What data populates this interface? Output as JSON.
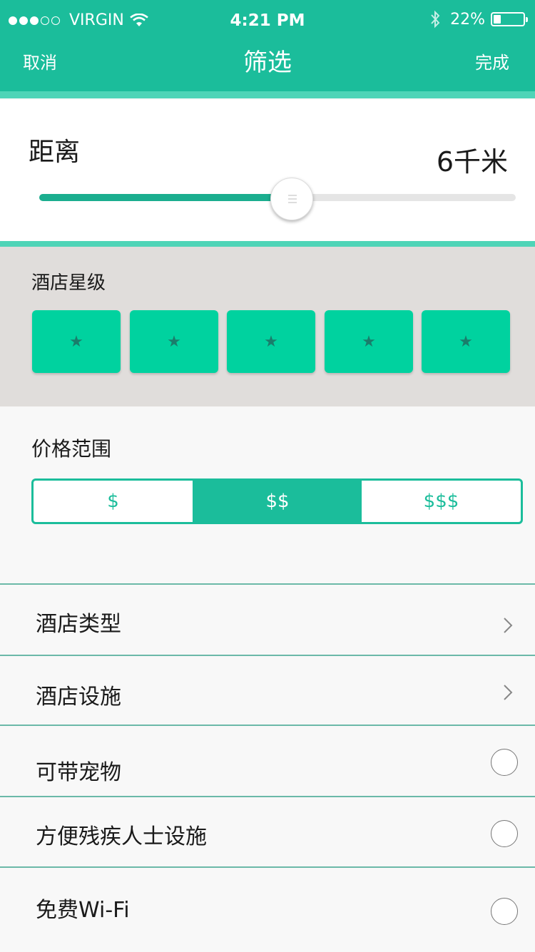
{
  "status": {
    "carrier": "VIRGIN",
    "time": "4:21 PM",
    "battery": "22%",
    "battery_level": 0.22
  },
  "nav": {
    "cancel": "取消",
    "title": "筛选",
    "done": "完成"
  },
  "distance": {
    "label": "距离",
    "value": "6千米",
    "slider_fraction": 0.53
  },
  "stars": {
    "title": "酒店星级",
    "items": [
      "★",
      "★",
      "★",
      "★",
      "★"
    ]
  },
  "price": {
    "title": "价格范围",
    "options": [
      "$",
      "$$",
      "$$$"
    ],
    "selected": "$$"
  },
  "list": [
    {
      "label": "酒店类型",
      "control": "chevron"
    },
    {
      "label": "酒店设施",
      "control": "chevron"
    },
    {
      "label": "可带宠物",
      "control": "radio"
    },
    {
      "label": "方便残疾人士设施",
      "control": "radio"
    },
    {
      "label": "免费Wi-Fi",
      "control": "radio"
    }
  ],
  "colors": {
    "primary": "#1bbd9b",
    "star_button": "#00d29f",
    "section_gray": "#e0dddb"
  },
  "icons": [
    "wifi-icon",
    "bluetooth-icon",
    "battery-icon",
    "star-icon",
    "chevron-right-icon",
    "radio-circle-icon"
  ]
}
